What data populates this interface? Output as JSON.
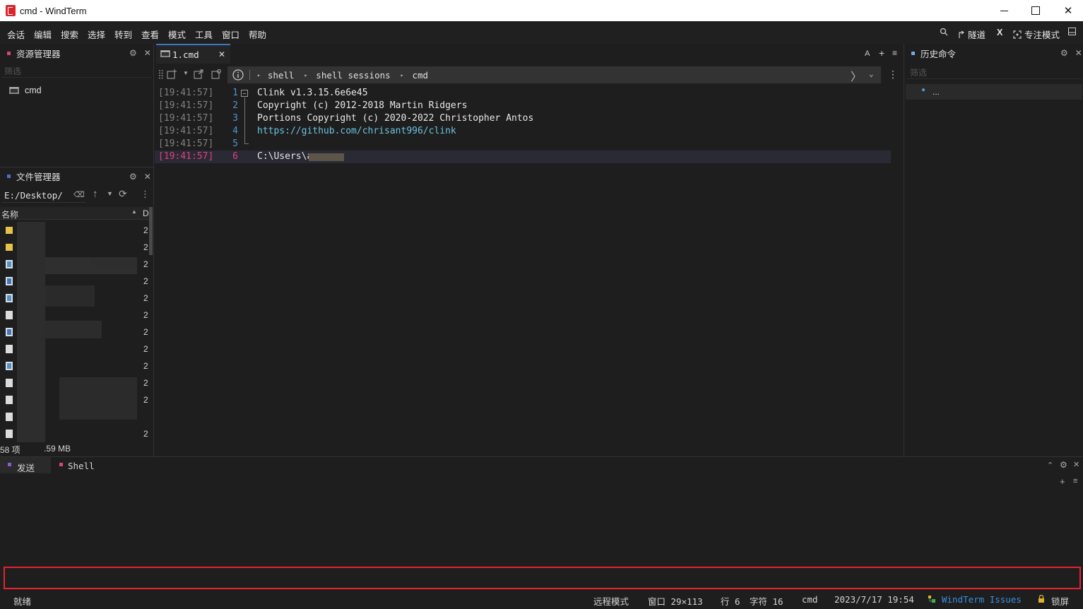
{
  "window": {
    "title": "cmd - WindTerm"
  },
  "menu": {
    "items": [
      "会话",
      "编辑",
      "搜索",
      "选择",
      "转到",
      "查看",
      "模式",
      "工具",
      "窗口",
      "帮助"
    ],
    "right": {
      "tunnel": "隧道",
      "x_label": "X",
      "focus_mode": "专注模式"
    }
  },
  "explorer": {
    "title": "资源管理器",
    "filter_placeholder": "筛选",
    "items": [
      {
        "label": "cmd"
      }
    ]
  },
  "file_manager": {
    "title": "文件管理器",
    "path": "E:/Desktop/",
    "column_name": "名称",
    "column_date": "D",
    "rows": [
      {
        "icon": "folder",
        "date": "2"
      },
      {
        "icon": "folder",
        "date": "2"
      },
      {
        "icon": "shortcut",
        "date": "2"
      },
      {
        "icon": "app",
        "date": "2"
      },
      {
        "icon": "shortcut",
        "date": "2"
      },
      {
        "icon": "document",
        "date": "2"
      },
      {
        "icon": "app",
        "date": "2"
      },
      {
        "icon": "document",
        "date": "2"
      },
      {
        "icon": "shortcut",
        "date": "2"
      },
      {
        "icon": "document",
        "date": "2"
      },
      {
        "icon": "document",
        "date": "2"
      },
      {
        "icon": "document",
        "date": ""
      },
      {
        "icon": "document",
        "date": "2"
      }
    ],
    "footer_count": "58 项",
    "footer_size": ".59 MB"
  },
  "terminal": {
    "tab_label": "1.cmd",
    "tab_tools": {
      "font": "A",
      "add": "+",
      "menu": "≡"
    },
    "breadcrumb": [
      "shell",
      "shell sessions",
      "cmd"
    ],
    "lines": [
      {
        "time": "[19:41:57]",
        "num": "1",
        "text": "Clink v1.3.15.6e6e45"
      },
      {
        "time": "[19:41:57]",
        "num": "2",
        "text": "Copyright (c) 2012-2018 Martin Ridgers"
      },
      {
        "time": "[19:41:57]",
        "num": "3",
        "text": "Portions Copyright (c) 2020-2022 Christopher Antos"
      },
      {
        "time": "[19:41:57]",
        "num": "4",
        "text": "https://github.com/chrisant996/clink"
      },
      {
        "time": "[19:41:57]",
        "num": "5",
        "text": ""
      },
      {
        "time": "[19:41:57]",
        "num": "6",
        "text": "C:\\Users\\a"
      }
    ]
  },
  "history": {
    "title": "历史命令",
    "filter_placeholder": "筛选",
    "items": [
      "..."
    ]
  },
  "bottom": {
    "tabs": [
      "发送",
      "Shell"
    ]
  },
  "status": {
    "ready": "就绪",
    "remote_mode": "远程模式",
    "window_size": "窗口 29×113",
    "row": "行 6",
    "col": "字符 16",
    "shell": "cmd",
    "datetime": "2023/7/17 19:54",
    "issues": "WindTerm Issues",
    "lock": "锁屏"
  },
  "colors": {
    "accent": "#3a78c2",
    "send_border": "#e8222e",
    "current_line_ts": "#e0407a",
    "link": "#6cc4e0"
  }
}
